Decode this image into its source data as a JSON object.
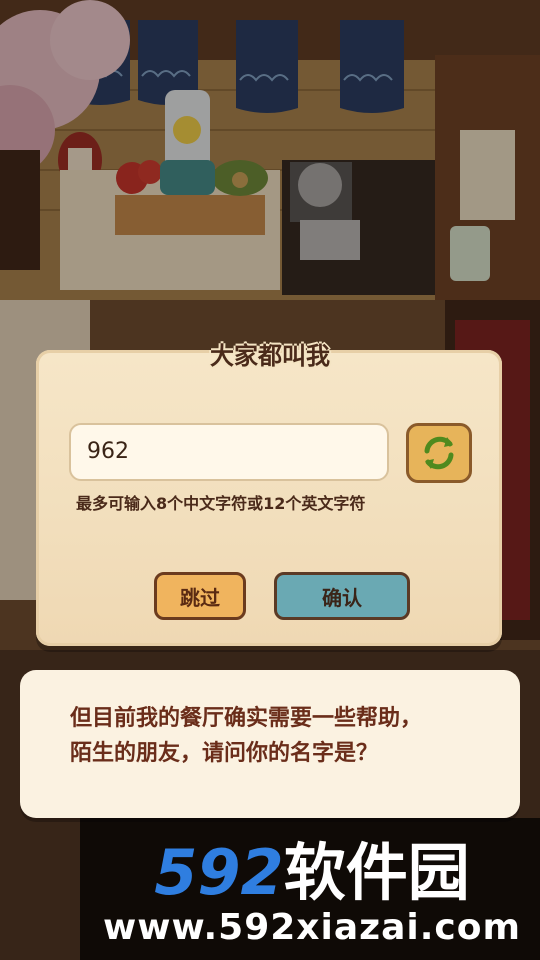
{
  "dialog": {
    "title": "大家都叫我",
    "name_value": "962",
    "refresh_icon": "refresh-icon",
    "hint": "最多可输入8个中文字符或12个英文字符",
    "skip_label": "跳过",
    "confirm_label": "确认"
  },
  "speech": {
    "line1": "但目前我的餐厅确实需要一些帮助，",
    "line2": "陌生的朋友，请问你的名字是？"
  },
  "watermark": {
    "title": "592软件园",
    "url": "www.592xiazai.com"
  },
  "colors": {
    "dialog_bg": "#f4e2c2",
    "skip_button": "#f0b45e",
    "confirm_button": "#6aa9b3",
    "refresh_button": "#e7b45a",
    "text_brown": "#4a2a1a"
  }
}
